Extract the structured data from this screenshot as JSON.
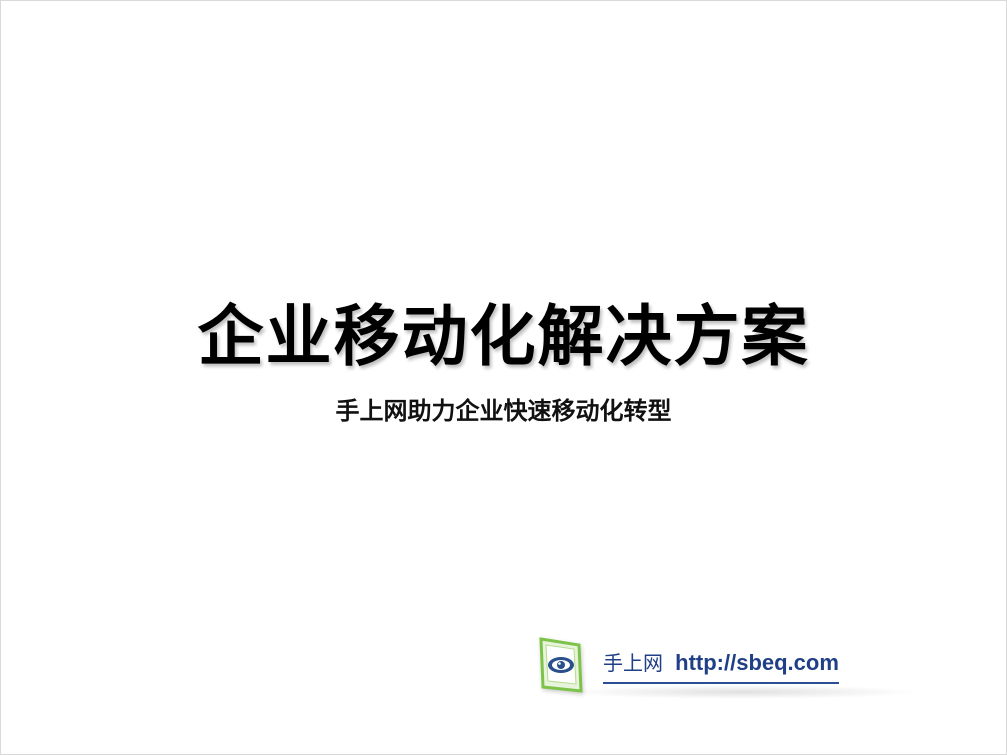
{
  "slide": {
    "title": "企业移动化解决方案",
    "subtitle": "手上网助力企业快速移动化转型"
  },
  "brand": {
    "name": "手上网",
    "url": "http://sbeq.com",
    "logo_icon": "sbeq-eye-logo-icon",
    "colors": {
      "text": "#1f3f86",
      "logo_green": "#7dc34a",
      "logo_blue": "#2b4f8c"
    }
  }
}
